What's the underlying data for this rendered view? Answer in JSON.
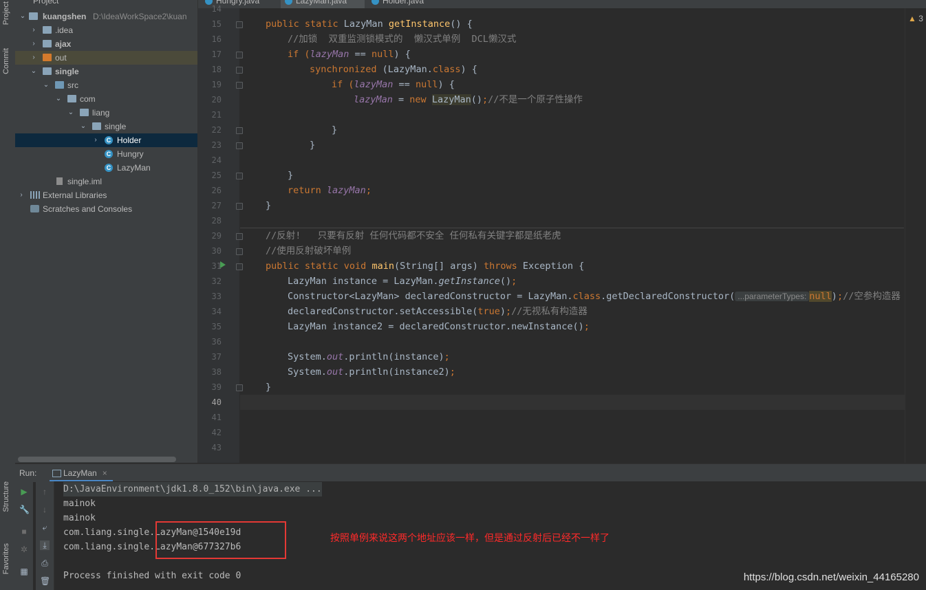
{
  "left_strip": {
    "project": "Project",
    "commit": "Commit",
    "structure": "Structure",
    "favorites": "Favorites"
  },
  "project_panel": {
    "title": "Project",
    "tree": [
      {
        "label": "kuangshen",
        "hint": "D:\\IdeaWorkSpace2\\kuan",
        "icon": "folder-icon",
        "bold": true
      },
      {
        "label": ".idea",
        "icon": "folder-icon"
      },
      {
        "label": "ajax",
        "icon": "folder-icon",
        "bold": true
      },
      {
        "label": "out",
        "icon": "folder-orange-icon"
      },
      {
        "label": "single",
        "icon": "folder-icon",
        "bold": true
      },
      {
        "label": "src",
        "icon": "folder-blue-icon"
      },
      {
        "label": "com",
        "icon": "folder-icon"
      },
      {
        "label": "liang",
        "icon": "folder-icon"
      },
      {
        "label": "single",
        "icon": "folder-icon"
      },
      {
        "label": "Holder",
        "icon": "class-icon",
        "selected": true
      },
      {
        "label": "Hungry",
        "icon": "class-icon"
      },
      {
        "label": "LazyMan",
        "icon": "class-icon"
      },
      {
        "label": "single.iml",
        "icon": "file-icon"
      },
      {
        "label": "External Libraries",
        "icon": "library-icon"
      },
      {
        "label": "Scratches and Consoles",
        "icon": "scratches-icon"
      }
    ]
  },
  "tabs": [
    {
      "label": "Hungry.java"
    },
    {
      "label": "LazyMan.java",
      "active": true
    },
    {
      "label": "Holder.java"
    }
  ],
  "editor": {
    "line_numbers": [
      "14",
      "15",
      "16",
      "17",
      "18",
      "19",
      "20",
      "21",
      "22",
      "23",
      "24",
      "25",
      "26",
      "27",
      "28",
      "29",
      "30",
      "31",
      "32",
      "33",
      "34",
      "35",
      "36",
      "37",
      "38",
      "39",
      "40",
      "41",
      "42",
      "43"
    ],
    "code": {
      "l15": [
        "public static ",
        "LazyMan ",
        "getInstance",
        "() {"
      ],
      "l16": "//加锁  双重监测锁模式的  懒汉式单例  DCL懒汉式",
      "l17": [
        "if (",
        "lazyMan",
        " == ",
        "null",
        ") {"
      ],
      "l18": [
        "synchronized ",
        "(LazyMan.",
        "class",
        ") {"
      ],
      "l19": [
        "if (",
        "lazyMan",
        " == ",
        "null",
        ") {"
      ],
      "l20": [
        "lazyMan",
        " = ",
        "new ",
        "LazyMan",
        "()",
        ";",
        "//不是一个原子性操作"
      ],
      "l22": "}",
      "l23": "}",
      "l25": "}",
      "l26": [
        "return ",
        "lazyMan",
        ";"
      ],
      "l27": "}",
      "l29": "//反射!   只要有反射 任何代码都不安全 任何私有关键字都是纸老虎",
      "l30": "//使用反射破坏单例",
      "l31": [
        "public static void ",
        "main",
        "(String[] args) ",
        "throws ",
        "Exception {"
      ],
      "l32": [
        "LazyMan instance = LazyMan.",
        "getInstance",
        "()",
        ";"
      ],
      "l33": [
        "Constructor<LazyMan> declaredConstructor = LazyMan.",
        "class",
        ".getDeclaredConstructor(",
        "...parameterTypes:",
        "null",
        ")",
        ";",
        "//空参构造器"
      ],
      "l34": [
        "declaredConstructor.setAccessible(",
        "true",
        ")",
        ";",
        "//无视私有构造器"
      ],
      "l35": [
        "LazyMan instance2 = declaredConstructor.newInstance()",
        ";"
      ],
      "l37": [
        "System.",
        "out",
        ".println(instance)",
        ";"
      ],
      "l38": [
        "System.",
        "out",
        ".println(instance2)",
        ";"
      ],
      "l39": "}"
    },
    "warning_count": "3"
  },
  "run": {
    "label": "Run:",
    "tab": "LazyMan",
    "console": [
      "D:\\JavaEnvironment\\jdk1.8.0_152\\bin\\java.exe ...",
      "mainok",
      "mainok",
      "com.liang.single.LazyMan@1540e19d",
      "com.liang.single.LazyMan@677327b6",
      "",
      "Process finished with exit code 0"
    ]
  },
  "annotation": "按照单例来说这两个地址应该一样，但是通过反射后已经不一样了",
  "watermark": "https://blog.csdn.net/weixin_44165280",
  "colors": {
    "keyword": "#cc7832",
    "method": "#ffc66d",
    "field": "#9876aa",
    "comment": "#808080",
    "annotation": "#ff2a2a",
    "selection": "#0d293e"
  }
}
